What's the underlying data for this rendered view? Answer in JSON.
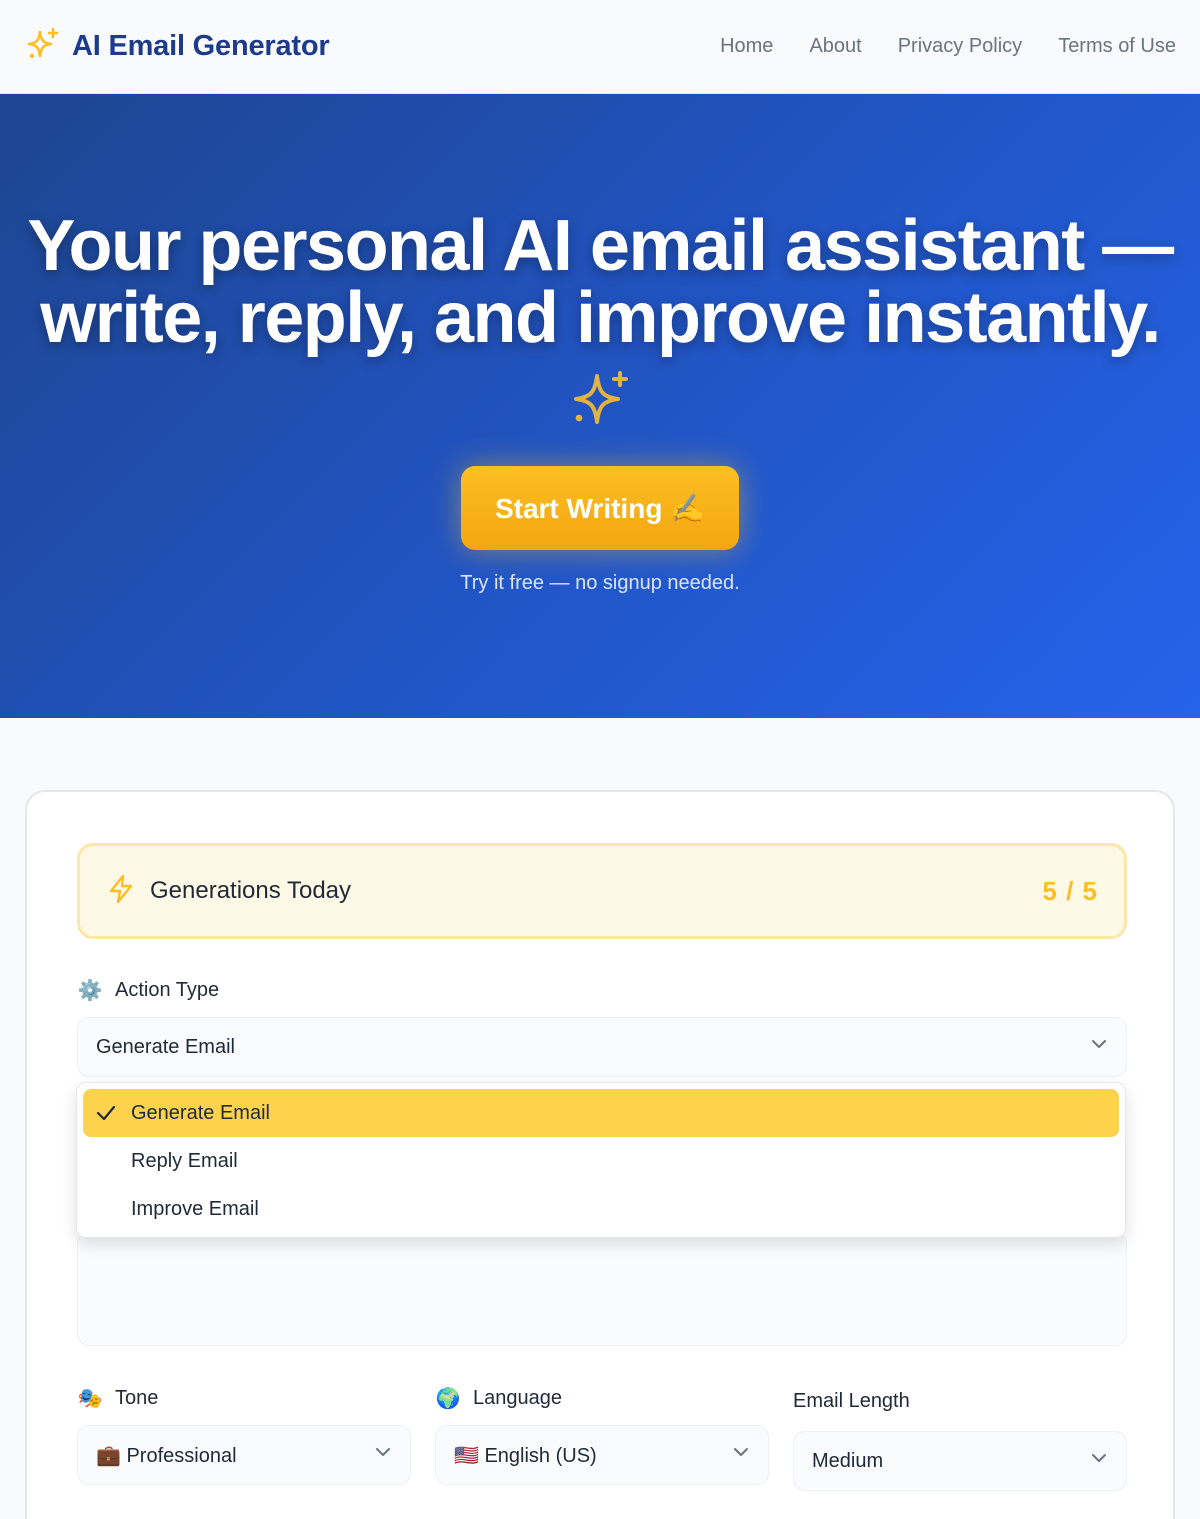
{
  "header": {
    "brand": "AI Email Generator",
    "nav": [
      "Home",
      "About",
      "Privacy Policy",
      "Terms of Use"
    ]
  },
  "hero": {
    "title_line1": "Your personal AI email assistant —",
    "title_line2": "write, reply, and improve instantly.",
    "cta_label": "Start Writing ✍️",
    "subtitle": "Try it free — no signup needed."
  },
  "usage": {
    "label": "Generations Today",
    "count": "5 / 5",
    "used": 5,
    "limit": 5
  },
  "action_type": {
    "label": "Action Type",
    "icon": "⚙️",
    "selected": "Generate Email",
    "options": [
      "Generate Email",
      "Reply Email",
      "Improve Email"
    ]
  },
  "tone": {
    "label": "Tone",
    "icon": "🎭",
    "selected": "💼 Professional"
  },
  "language": {
    "label": "Language",
    "icon": "🌍",
    "selected": "🇺🇸 English (US)"
  },
  "length": {
    "label": "Email Length",
    "selected": "Medium"
  },
  "colors": {
    "brand": "#1e3a8a",
    "accent": "#fbbf24",
    "hero_start": "#1e4590",
    "hero_end": "#2563eb",
    "selected_option": "#fdd34d"
  }
}
